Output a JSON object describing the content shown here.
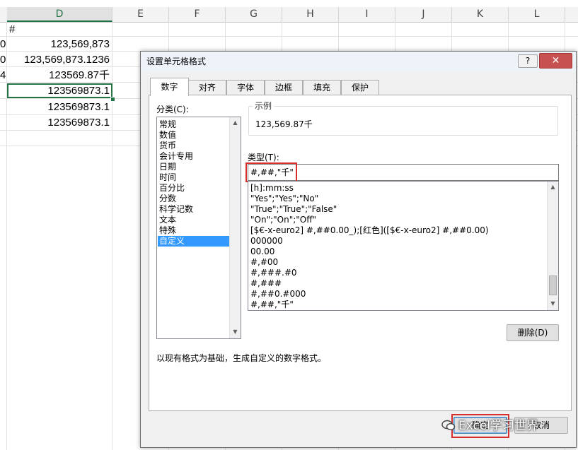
{
  "sheet": {
    "columns": [
      "D",
      "E",
      "F",
      "G",
      "H",
      "I",
      "J",
      "K",
      "L"
    ],
    "selected_column": "D",
    "partial_left_cells": [
      "0",
      "0",
      "4"
    ],
    "cells": [
      "#",
      "123,569,873",
      "123,569,873.1236",
      "123569.87千",
      "123569873.1",
      "123569873.1",
      "123569873.1"
    ]
  },
  "dialog": {
    "title": "设置单元格格式",
    "help_label": "?",
    "close_label": "✕",
    "tabs": [
      {
        "label": "数字",
        "active": true
      },
      {
        "label": "对齐",
        "active": false
      },
      {
        "label": "字体",
        "active": false
      },
      {
        "label": "边框",
        "active": false
      },
      {
        "label": "填充",
        "active": false
      },
      {
        "label": "保护",
        "active": false
      }
    ],
    "category_label": "分类(C):",
    "categories": [
      "常规",
      "数值",
      "货币",
      "会计专用",
      "日期",
      "时间",
      "百分比",
      "分数",
      "科学记数",
      "文本",
      "特殊",
      "自定义"
    ],
    "selected_category": "自定义",
    "sample_label": "示例",
    "sample_value": "123,569.87千",
    "type_label": "类型(T):",
    "type_value": "#,##,\"千\"",
    "format_list": [
      "[h]:mm:ss",
      "\"Yes\";\"Yes\";\"No\"",
      "\"True\";\"True\";\"False\"",
      "\"On\";\"On\";\"Off\"",
      "[$€-x-euro2] #,##0.00_);[红色]([$€-x-euro2] #,##0.00)",
      "000000",
      "00.00",
      "#,#00",
      "#,###.#0",
      "#,###",
      "#,##0.#000",
      "#,##,\"千\""
    ],
    "delete_button": "删除(D)",
    "description": "以现有格式为基础，生成自定义的数字格式。",
    "ok_button": "确定",
    "cancel_button": "取消"
  },
  "watermark": "Excel学习世界",
  "colors": {
    "accent_green": "#217346",
    "highlight_red": "#d72f2f",
    "selection_blue": "#3399ff"
  }
}
